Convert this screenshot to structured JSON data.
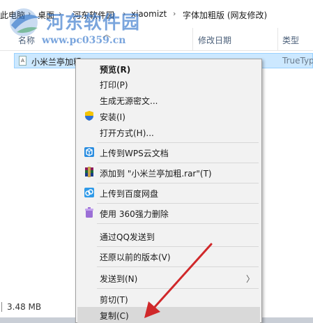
{
  "address": {
    "segments": [
      "此电脑",
      "桌面",
      "河东软件园",
      "xiaomizt",
      "字体加粗版 (网友修改)"
    ],
    "separator": "›"
  },
  "watermark": {
    "title": "河东软件园",
    "url": "www.pc0359.cn"
  },
  "columns": {
    "name": "名称",
    "date": "修改日期",
    "type": "类型"
  },
  "file": {
    "name": "小米兰亭加粗",
    "type": "TrueTyp",
    "icon_letter": "A"
  },
  "context_menu": {
    "items": [
      {
        "label": "预览(R)",
        "bold": true,
        "icon": ""
      },
      {
        "label": "打印(P)",
        "icon": ""
      },
      {
        "label": "生成无源密文...",
        "icon": ""
      },
      {
        "label": "安装(I)",
        "icon": "shield-icon"
      },
      {
        "label": "打开方式(H)...",
        "icon": ""
      },
      {
        "label": "上传到WPS云文档",
        "icon": "wps-cloud-icon"
      },
      {
        "label": "添加到 \"小米兰亭加粗.rar\"(T)",
        "icon": "winrar-icon"
      },
      {
        "label": "上传到百度网盘",
        "icon": "baidu-netdisk-icon"
      },
      {
        "label": "使用 360强力删除",
        "icon": "360-delete-icon"
      },
      {
        "label": "通过QQ发送到",
        "icon": ""
      },
      {
        "label": "还原以前的版本(V)",
        "icon": ""
      },
      {
        "label": "发送到(N)",
        "icon": "",
        "submenu": true
      },
      {
        "label": "剪切(T)",
        "icon": ""
      },
      {
        "label": "复制(C)",
        "icon": "",
        "highlighted": true
      }
    ],
    "submenu_arrow": "〉"
  },
  "status": {
    "size": "3.48 MB"
  },
  "colors": {
    "selection": "#cce8ff",
    "menu_bg": "#f2f2f2",
    "arrow": "#d0282a",
    "watermark": "#286ec8"
  }
}
